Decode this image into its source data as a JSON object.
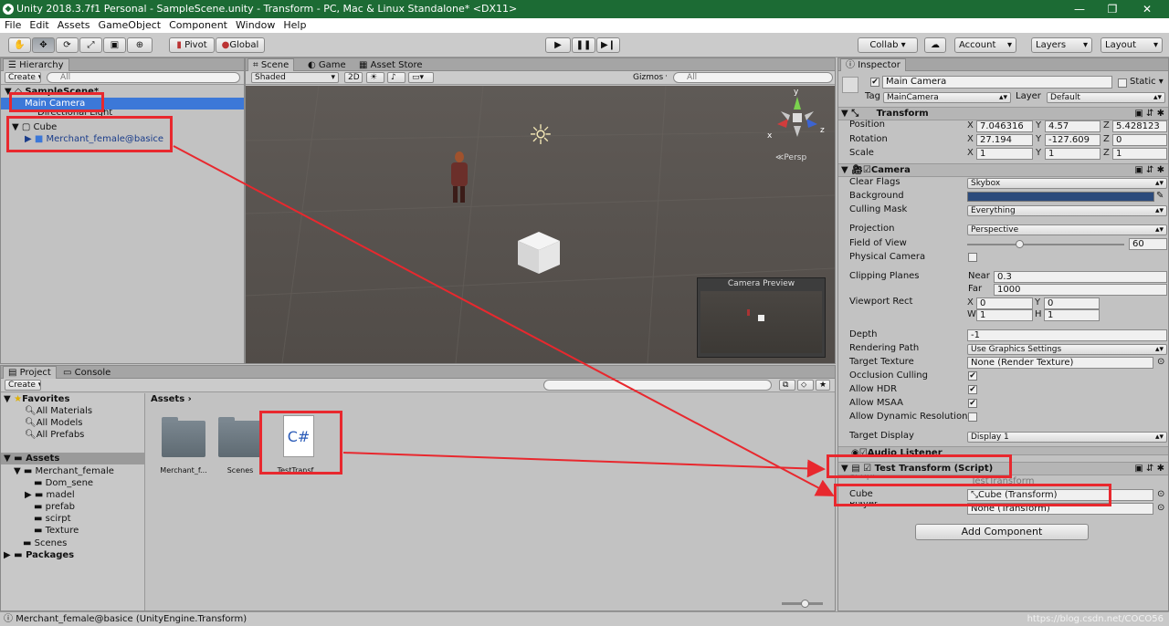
{
  "window": {
    "title": "Unity 2018.3.7f1 Personal - SampleScene.unity - Transform - PC, Mac & Linux Standalone* <DX11>",
    "min": "—",
    "max": "❐",
    "close": "✕"
  },
  "menu": [
    "File",
    "Edit",
    "Assets",
    "GameObject",
    "Component",
    "Window",
    "Help"
  ],
  "toolbar": {
    "pivot": "Pivot",
    "global": "Global",
    "collab": "Collab ▾",
    "account": "Account",
    "layers": "Layers",
    "layout": "Layout"
  },
  "hierarchy": {
    "tab": "Hierarchy",
    "create": "Create",
    "search_placeholder": "All",
    "scene": "SampleScene*",
    "items": [
      "Main Camera",
      "Directional Light",
      "Cube",
      "Merchant_female@basice"
    ]
  },
  "scene_view": {
    "tabs": [
      "Scene",
      "Game",
      "Asset Store"
    ],
    "shading": "Shaded",
    "mode_2d": "2D",
    "gizmos": "Gizmos",
    "search_placeholder": "All",
    "persp": "Persp",
    "preview_title": "Camera Preview",
    "axis_y": "y",
    "axis_x": "x",
    "axis_z": "z"
  },
  "project": {
    "tabs": [
      "Project",
      "Console"
    ],
    "create": "Create",
    "favorites": "Favorites",
    "favorite_items": [
      "All Materials",
      "All Models",
      "All Prefabs"
    ],
    "assets_root": "Assets",
    "tree": [
      "Merchant_female",
      "Dom_sene",
      "madel",
      "prefab",
      "scirpt",
      "Texture",
      "Scenes"
    ],
    "packages": "Packages",
    "breadcrumb": "Assets",
    "files": [
      {
        "label": "Merchant_f...",
        "kind": "folder"
      },
      {
        "label": "Scenes",
        "kind": "folder"
      },
      {
        "label": "TestTransf...",
        "kind": "script"
      }
    ],
    "script_icon_text": "C#"
  },
  "status_bar": {
    "text": "Merchant_female@basice (UnityEngine.Transform)",
    "watermark": "https://blog.csdn.net/COCO56"
  },
  "inspector": {
    "tab": "Inspector",
    "object_name": "Main Camera",
    "static_label": "Static",
    "tag_label": "Tag",
    "tag_value": "MainCamera",
    "layer_label": "Layer",
    "layer_value": "Default",
    "transform": {
      "title": "Transform",
      "position_label": "Position",
      "rotation_label": "Rotation",
      "scale_label": "Scale",
      "position": [
        "7.046316",
        "4.57",
        "5.428123"
      ],
      "rotation": [
        "27.194",
        "-127.609",
        "0"
      ],
      "scale": [
        "1",
        "1",
        "1"
      ]
    },
    "camera": {
      "title": "Camera",
      "clear_flags_label": "Clear Flags",
      "clear_flags": "Skybox",
      "background_label": "Background",
      "background_color": "#2c4b7c",
      "culling_mask_label": "Culling Mask",
      "culling_mask": "Everything",
      "projection_label": "Projection",
      "projection": "Perspective",
      "fov_label": "Field of View",
      "fov": "60",
      "fov_fraction": 0.33,
      "physical_label": "Physical Camera",
      "clipping_label": "Clipping Planes",
      "near_label": "Near",
      "near": "0.3",
      "far_label": "Far",
      "far": "1000",
      "viewport_label": "Viewport Rect",
      "vx": "0",
      "vy": "0",
      "vw": "1",
      "vh": "1",
      "depth_label": "Depth",
      "depth": "-1",
      "rendering_path_label": "Rendering Path",
      "rendering_path": "Use Graphics Settings",
      "target_texture_label": "Target Texture",
      "target_texture": "None (Render Texture)",
      "occlusion_label": "Occlusion Culling",
      "hdr_label": "Allow HDR",
      "msaa_label": "Allow MSAA",
      "dynres_label": "Allow Dynamic Resolution",
      "target_display_label": "Target Display",
      "target_display": "Display 1"
    },
    "audio_listener": "Audio Listener",
    "test_transform": {
      "title": "Test Transform (Script)",
      "script_label": "Script",
      "script_value": "TestTransform",
      "cube_label": "Cube",
      "cube_value": "Cube (Transform)",
      "player_label": "Player",
      "player_value": "None (Transform)"
    },
    "add_component": "Add Component"
  },
  "colors": {
    "annotation_red": "#e8282e",
    "selection_blue": "#3c78d8",
    "title_green": "#1c6b34"
  }
}
